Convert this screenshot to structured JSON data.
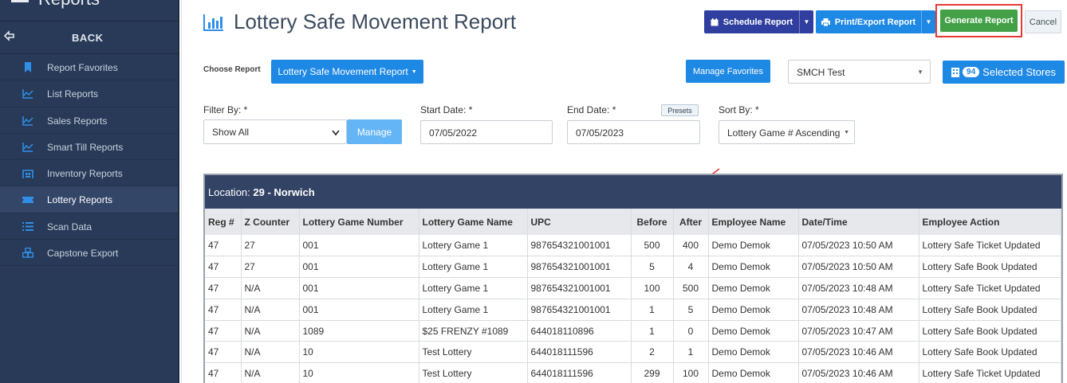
{
  "sidebar": {
    "title": "Reports",
    "back": "BACK",
    "items": [
      {
        "label": "Report Favorites"
      },
      {
        "label": "List Reports"
      },
      {
        "label": "Sales Reports"
      },
      {
        "label": "Smart Till Reports"
      },
      {
        "label": "Inventory Reports"
      },
      {
        "label": "Lottery Reports"
      },
      {
        "label": "Scan Data"
      },
      {
        "label": "Capstone Export"
      }
    ]
  },
  "header": {
    "title": "Lottery Safe Movement Report",
    "schedule": "Schedule Report",
    "print": "Print/Export Report",
    "generate": "Generate Report",
    "cancel": "Cancel"
  },
  "toolbar": {
    "choose_label": "Choose Report",
    "choose_value": "Lottery Safe Movement Report",
    "manage_favorites": "Manage Favorites",
    "store_value": "SMCH Test",
    "stores_count": "94",
    "stores_label": "Selected Stores"
  },
  "filters": {
    "filter_label": "Filter By: *",
    "filter_value": "Show All",
    "manage": "Manage",
    "start_label": "Start Date: *",
    "start_value": "07/05/2022",
    "end_label": "End Date: *",
    "end_value": "07/05/2023",
    "presets": "Presets",
    "sort_label": "Sort By: *",
    "sort_value": "Lottery Game # Ascending"
  },
  "report": {
    "location_label": "Location:",
    "location_value": "29 - Norwich",
    "columns": [
      "Reg #",
      "Z Counter",
      "Lottery Game Number",
      "Lottery Game Name",
      "UPC",
      "Before",
      "After",
      "Employee Name",
      "Date/Time",
      "Employee Action"
    ],
    "rows": [
      [
        "47",
        "27",
        "001",
        "Lottery Game 1",
        "987654321001001",
        "500",
        "400",
        "Demo Demok",
        "07/05/2023 10:50 AM",
        "Lottery Safe Ticket Updated"
      ],
      [
        "47",
        "27",
        "001",
        "Lottery Game 1",
        "987654321001001",
        "5",
        "4",
        "Demo Demok",
        "07/05/2023 10:50 AM",
        "Lottery Safe Book Updated"
      ],
      [
        "47",
        "N/A",
        "001",
        "Lottery Game 1",
        "987654321001001",
        "100",
        "500",
        "Demo Demok",
        "07/05/2023 10:48 AM",
        "Lottery Safe Ticket Updated"
      ],
      [
        "47",
        "N/A",
        "001",
        "Lottery Game 1",
        "987654321001001",
        "1",
        "5",
        "Demo Demok",
        "07/05/2023 10:48 AM",
        "Lottery Safe Book Updated"
      ],
      [
        "47",
        "N/A",
        "1089",
        "$25 FRENZY #1089",
        "644018110896",
        "1",
        "0",
        "Demo Demok",
        "07/05/2023 10:47 AM",
        "Lottery Safe Book Updated"
      ],
      [
        "47",
        "N/A",
        "10",
        "Test Lottery",
        "644018111596",
        "2",
        "1",
        "Demo Demok",
        "07/05/2023 10:46 AM",
        "Lottery Safe Book Updated"
      ],
      [
        "47",
        "N/A",
        "10",
        "Test Lottery",
        "644018111596",
        "299",
        "100",
        "Demo Demok",
        "07/05/2023 10:46 AM",
        "Lottery Safe Ticket Updated"
      ]
    ]
  },
  "colors": {
    "sidebar": "#283a57",
    "primary": "#1e88e5",
    "schedule": "#303f9f",
    "generate": "#43a047",
    "highlight": "#e53935"
  }
}
